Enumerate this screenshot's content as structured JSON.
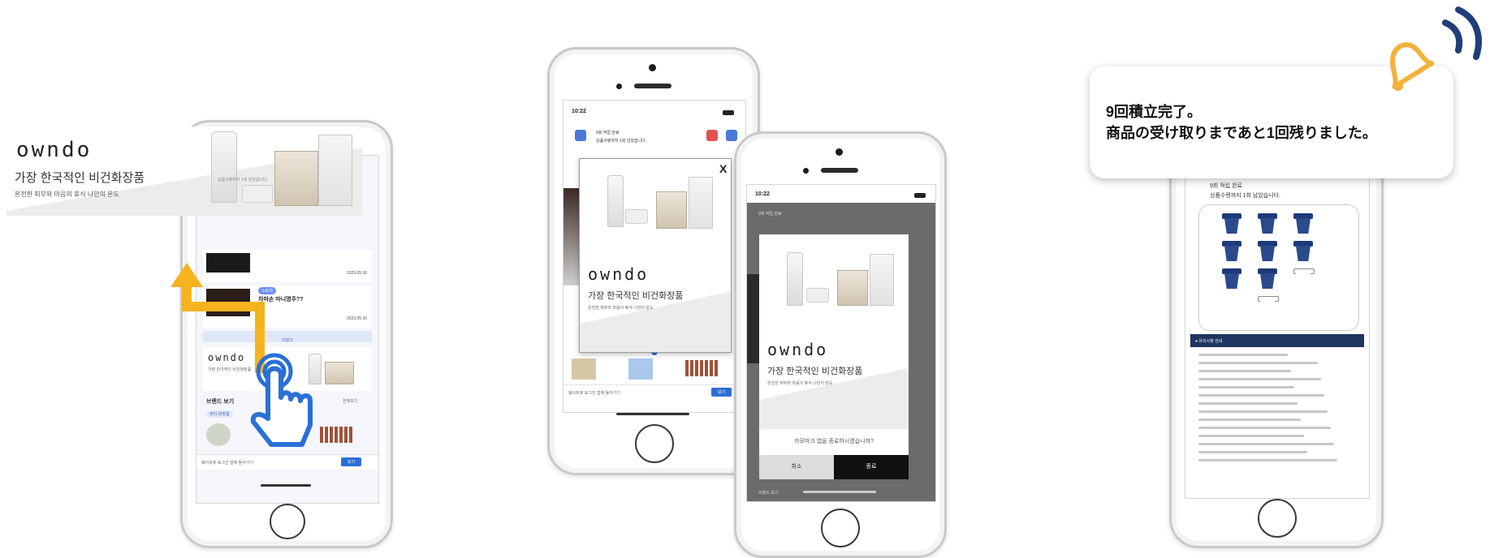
{
  "brand": {
    "name": "owndo",
    "tagline": "가장 한국적인 비건화장품",
    "subline": "온전한 피부와 마음의 휴식 나만의 온도"
  },
  "stamp_header": {
    "title": "9회 적립 완료",
    "subtitle": "상품수령까지 1회 남았습니다."
  },
  "phone1": {
    "card_title": "차마손 마니명주??",
    "card_badge": "스토리",
    "card_date1": "2023.05.30",
    "card_date2": "2023.05.30",
    "more_button": "더보기",
    "section_title": "브랜드 보기",
    "section_more": "전체보기",
    "filter_chip": "뷰티·화장품",
    "bottom_bar_text": "웨이트봇 로그인 앱에 들어가기",
    "bottom_bar_button": "보기"
  },
  "phone2": {
    "status_time": "10:22",
    "popup_close": "X",
    "bottom_bar_text": "웨이트봇 로그인 앱에 들어가기",
    "bottom_bar_button": "보기"
  },
  "phone3": {
    "status_time": "10:22",
    "exit_question": "카모마크 앱을 종료하시겠습니까?",
    "cancel_button": "취소",
    "confirm_button": "종료",
    "bottom_text": "브랜드 보기"
  },
  "phone4": {
    "notice_title": "● 유의사항 안내"
  },
  "notification": {
    "line1": "9回積立完了。",
    "line2": "商品の受け取りまであと1回残りました。"
  },
  "colors": {
    "arrow": "#f5b41e",
    "hand": "#2b6fd6",
    "bell": "#f3b13a",
    "signal": "#1f3f7a",
    "cup": "#1e3a78",
    "notice_bar": "#1d3560"
  }
}
